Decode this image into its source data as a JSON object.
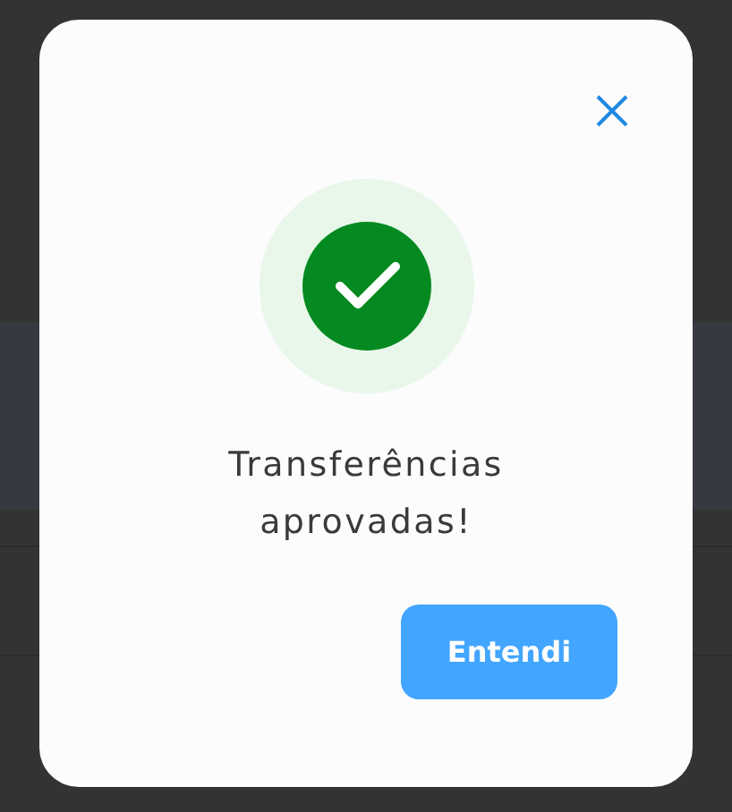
{
  "dialog": {
    "message": "Transferências aprovadas!",
    "button": "Entendi"
  }
}
